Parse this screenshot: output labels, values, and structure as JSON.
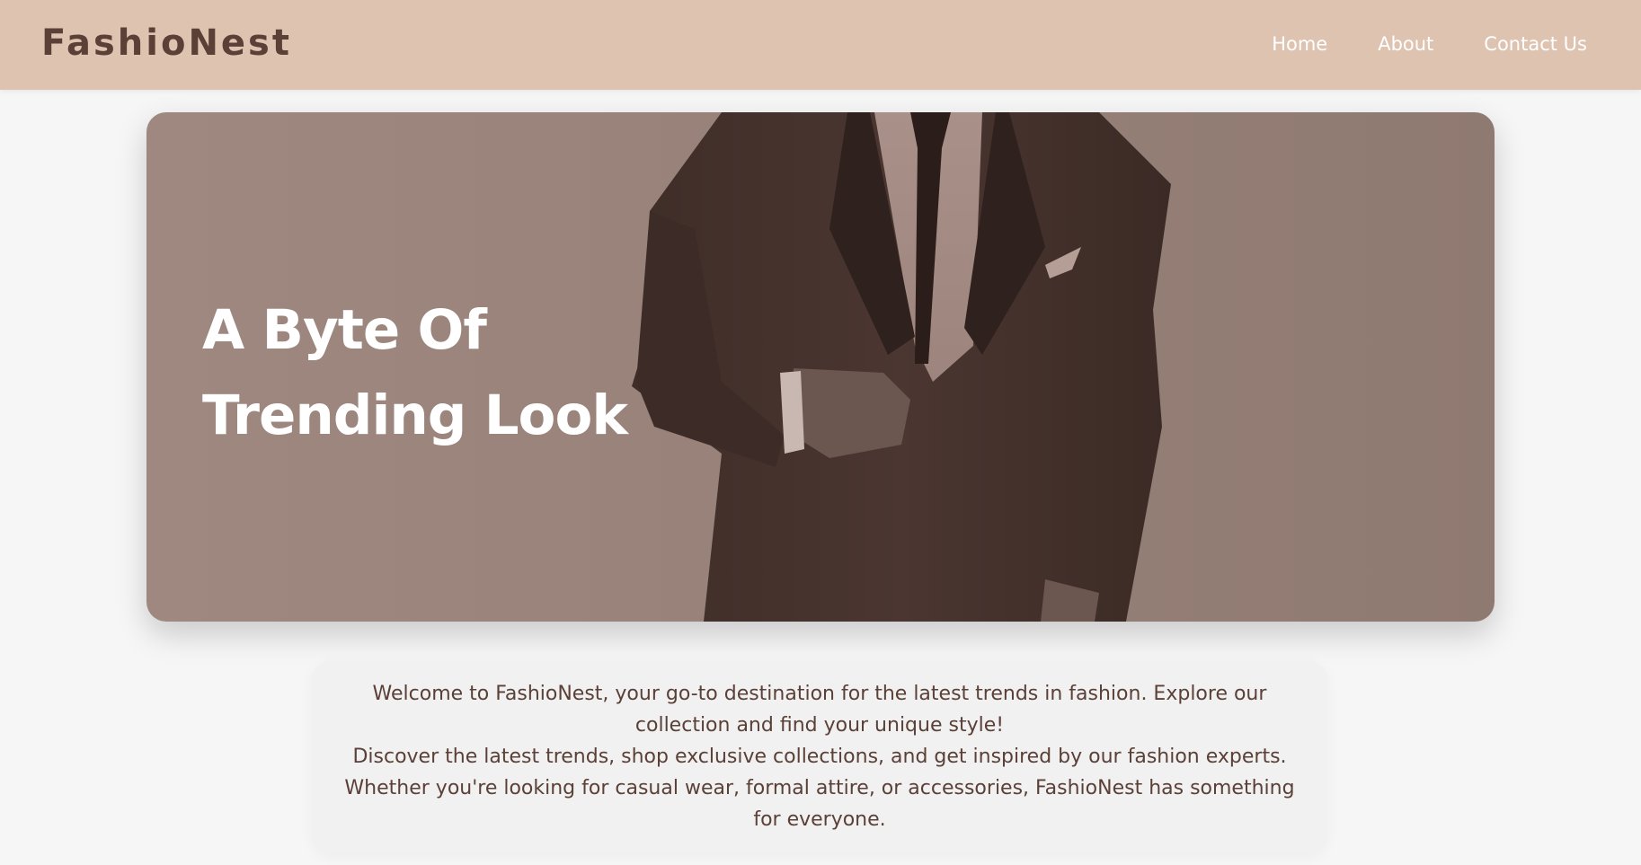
{
  "header": {
    "brand": "FashioNest",
    "nav": [
      {
        "label": "Home"
      },
      {
        "label": "About"
      },
      {
        "label": "Contact Us"
      }
    ]
  },
  "hero": {
    "title_line1": "A Byte Of",
    "title_line2": "Trending Look",
    "image": "man-in-suit-photo"
  },
  "intro": {
    "paragraph1": "Welcome to FashioNest, your go-to destination for the latest trends in fashion. Explore our collection and find your unique style!",
    "paragraph2": "Discover the latest trends, shop exclusive collections, and get inspired by our fashion experts. Whether you're looking for casual wear, formal attire, or accessories, FashioNest has something for everyone."
  },
  "colors": {
    "header_bg": "#dfc3b1",
    "brand_text": "#5b4037",
    "nav_text": "#ffffff",
    "hero_bg": "#9e8880",
    "suit": "#4a3530",
    "page_bg": "#f6f6f6"
  }
}
